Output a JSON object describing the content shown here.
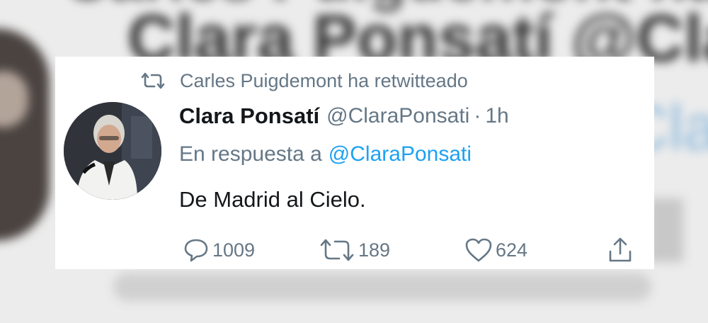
{
  "retweet_context": {
    "icon": "retweet-icon",
    "text": "Carles Puigdemont ha retwitteado"
  },
  "tweet": {
    "display_name": "Clara Ponsatí",
    "handle": "@ClaraPonsati",
    "separator": "·",
    "time": "1h",
    "reply_prefix": "En respuesta a",
    "reply_to": "@ClaraPonsati",
    "text": "De Madrid al Cielo."
  },
  "actions": {
    "reply": {
      "icon": "reply-icon",
      "count": "1009"
    },
    "retweet": {
      "icon": "retweet-icon",
      "count": "189"
    },
    "like": {
      "icon": "heart-icon",
      "count": "624"
    },
    "share": {
      "icon": "share-icon"
    }
  },
  "background": {
    "top_text": "Carles Puigdemont ha",
    "name_text": "Clara Ponsatí @Cla",
    "reply_text": "Cla"
  },
  "colors": {
    "secondary_text": "#657786",
    "primary_text": "#14171a",
    "link": "#1da1f2",
    "card": "#ffffff"
  }
}
